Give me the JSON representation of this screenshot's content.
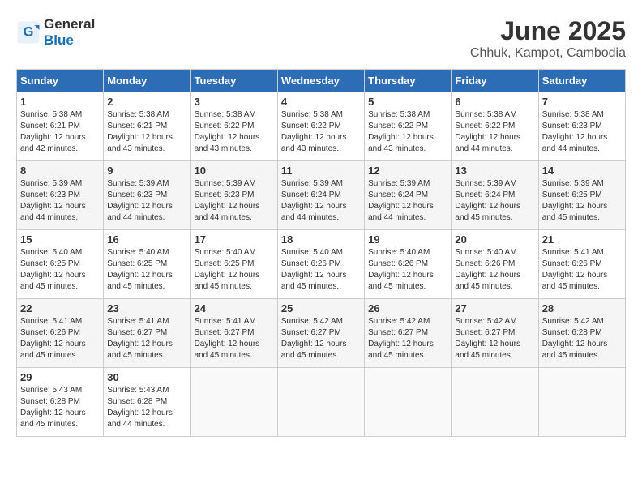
{
  "header": {
    "logo_general": "General",
    "logo_blue": "Blue",
    "month_title": "June 2025",
    "location": "Chhuk, Kampot, Cambodia"
  },
  "days_of_week": [
    "Sunday",
    "Monday",
    "Tuesday",
    "Wednesday",
    "Thursday",
    "Friday",
    "Saturday"
  ],
  "weeks": [
    [
      {
        "day": "1",
        "sunrise": "5:38 AM",
        "sunset": "6:21 PM",
        "daylight": "12 hours and 42 minutes."
      },
      {
        "day": "2",
        "sunrise": "5:38 AM",
        "sunset": "6:21 PM",
        "daylight": "12 hours and 43 minutes."
      },
      {
        "day": "3",
        "sunrise": "5:38 AM",
        "sunset": "6:22 PM",
        "daylight": "12 hours and 43 minutes."
      },
      {
        "day": "4",
        "sunrise": "5:38 AM",
        "sunset": "6:22 PM",
        "daylight": "12 hours and 43 minutes."
      },
      {
        "day": "5",
        "sunrise": "5:38 AM",
        "sunset": "6:22 PM",
        "daylight": "12 hours and 43 minutes."
      },
      {
        "day": "6",
        "sunrise": "5:38 AM",
        "sunset": "6:22 PM",
        "daylight": "12 hours and 44 minutes."
      },
      {
        "day": "7",
        "sunrise": "5:38 AM",
        "sunset": "6:23 PM",
        "daylight": "12 hours and 44 minutes."
      }
    ],
    [
      {
        "day": "8",
        "sunrise": "5:39 AM",
        "sunset": "6:23 PM",
        "daylight": "12 hours and 44 minutes."
      },
      {
        "day": "9",
        "sunrise": "5:39 AM",
        "sunset": "6:23 PM",
        "daylight": "12 hours and 44 minutes."
      },
      {
        "day": "10",
        "sunrise": "5:39 AM",
        "sunset": "6:23 PM",
        "daylight": "12 hours and 44 minutes."
      },
      {
        "day": "11",
        "sunrise": "5:39 AM",
        "sunset": "6:24 PM",
        "daylight": "12 hours and 44 minutes."
      },
      {
        "day": "12",
        "sunrise": "5:39 AM",
        "sunset": "6:24 PM",
        "daylight": "12 hours and 44 minutes."
      },
      {
        "day": "13",
        "sunrise": "5:39 AM",
        "sunset": "6:24 PM",
        "daylight": "12 hours and 45 minutes."
      },
      {
        "day": "14",
        "sunrise": "5:39 AM",
        "sunset": "6:25 PM",
        "daylight": "12 hours and 45 minutes."
      }
    ],
    [
      {
        "day": "15",
        "sunrise": "5:40 AM",
        "sunset": "6:25 PM",
        "daylight": "12 hours and 45 minutes."
      },
      {
        "day": "16",
        "sunrise": "5:40 AM",
        "sunset": "6:25 PM",
        "daylight": "12 hours and 45 minutes."
      },
      {
        "day": "17",
        "sunrise": "5:40 AM",
        "sunset": "6:25 PM",
        "daylight": "12 hours and 45 minutes."
      },
      {
        "day": "18",
        "sunrise": "5:40 AM",
        "sunset": "6:26 PM",
        "daylight": "12 hours and 45 minutes."
      },
      {
        "day": "19",
        "sunrise": "5:40 AM",
        "sunset": "6:26 PM",
        "daylight": "12 hours and 45 minutes."
      },
      {
        "day": "20",
        "sunrise": "5:40 AM",
        "sunset": "6:26 PM",
        "daylight": "12 hours and 45 minutes."
      },
      {
        "day": "21",
        "sunrise": "5:41 AM",
        "sunset": "6:26 PM",
        "daylight": "12 hours and 45 minutes."
      }
    ],
    [
      {
        "day": "22",
        "sunrise": "5:41 AM",
        "sunset": "6:26 PM",
        "daylight": "12 hours and 45 minutes."
      },
      {
        "day": "23",
        "sunrise": "5:41 AM",
        "sunset": "6:27 PM",
        "daylight": "12 hours and 45 minutes."
      },
      {
        "day": "24",
        "sunrise": "5:41 AM",
        "sunset": "6:27 PM",
        "daylight": "12 hours and 45 minutes."
      },
      {
        "day": "25",
        "sunrise": "5:42 AM",
        "sunset": "6:27 PM",
        "daylight": "12 hours and 45 minutes."
      },
      {
        "day": "26",
        "sunrise": "5:42 AM",
        "sunset": "6:27 PM",
        "daylight": "12 hours and 45 minutes."
      },
      {
        "day": "27",
        "sunrise": "5:42 AM",
        "sunset": "6:27 PM",
        "daylight": "12 hours and 45 minutes."
      },
      {
        "day": "28",
        "sunrise": "5:42 AM",
        "sunset": "6:28 PM",
        "daylight": "12 hours and 45 minutes."
      }
    ],
    [
      {
        "day": "29",
        "sunrise": "5:43 AM",
        "sunset": "6:28 PM",
        "daylight": "12 hours and 45 minutes."
      },
      {
        "day": "30",
        "sunrise": "5:43 AM",
        "sunset": "6:28 PM",
        "daylight": "12 hours and 44 minutes."
      },
      null,
      null,
      null,
      null,
      null
    ]
  ]
}
